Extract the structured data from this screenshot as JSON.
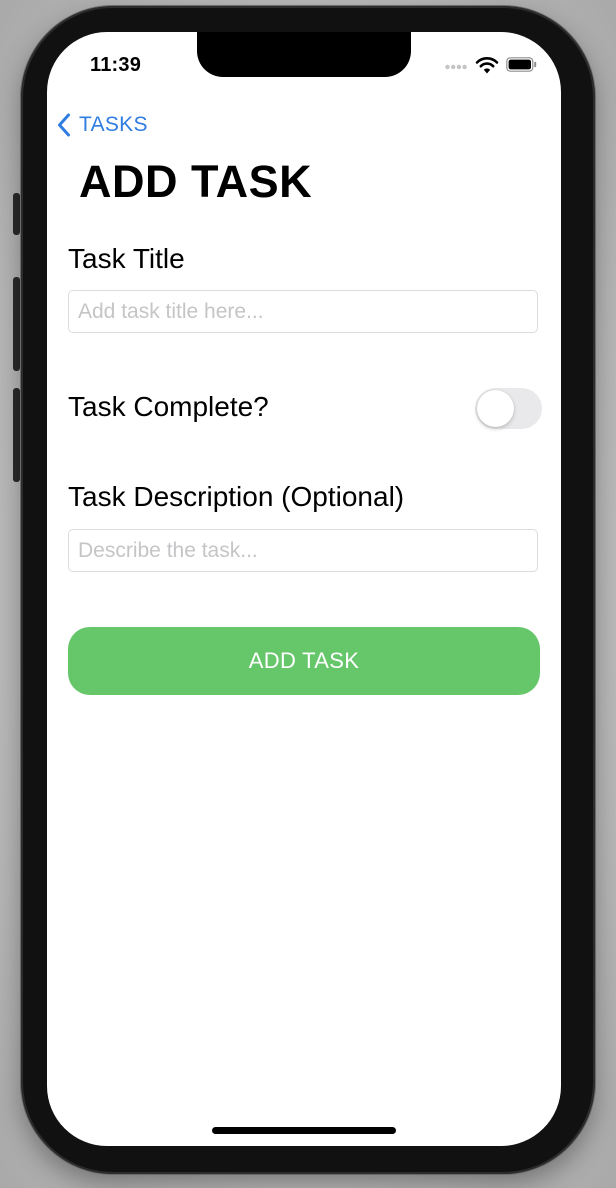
{
  "status_bar": {
    "time": "11:39",
    "icons": [
      "cellular-signal-icon",
      "wifi-icon",
      "battery-icon"
    ]
  },
  "nav": {
    "back_label": "TASKS",
    "back_icon": "chevron-left-icon"
  },
  "page": {
    "title": "ADD TASK"
  },
  "form": {
    "title_label": "Task Title",
    "title_placeholder": "Add task title here...",
    "title_value": "",
    "complete_label": "Task Complete?",
    "complete_value": false,
    "description_label": "Task Description (Optional)",
    "description_placeholder": "Describe the task...",
    "description_value": "",
    "submit_label": "ADD TASK"
  },
  "colors": {
    "accent": "#2f7de1",
    "submit_button": "#66c66a",
    "toggle_off": "#e9e9eb",
    "input_border": "#dcdcdc",
    "placeholder": "#c5c5c7"
  }
}
